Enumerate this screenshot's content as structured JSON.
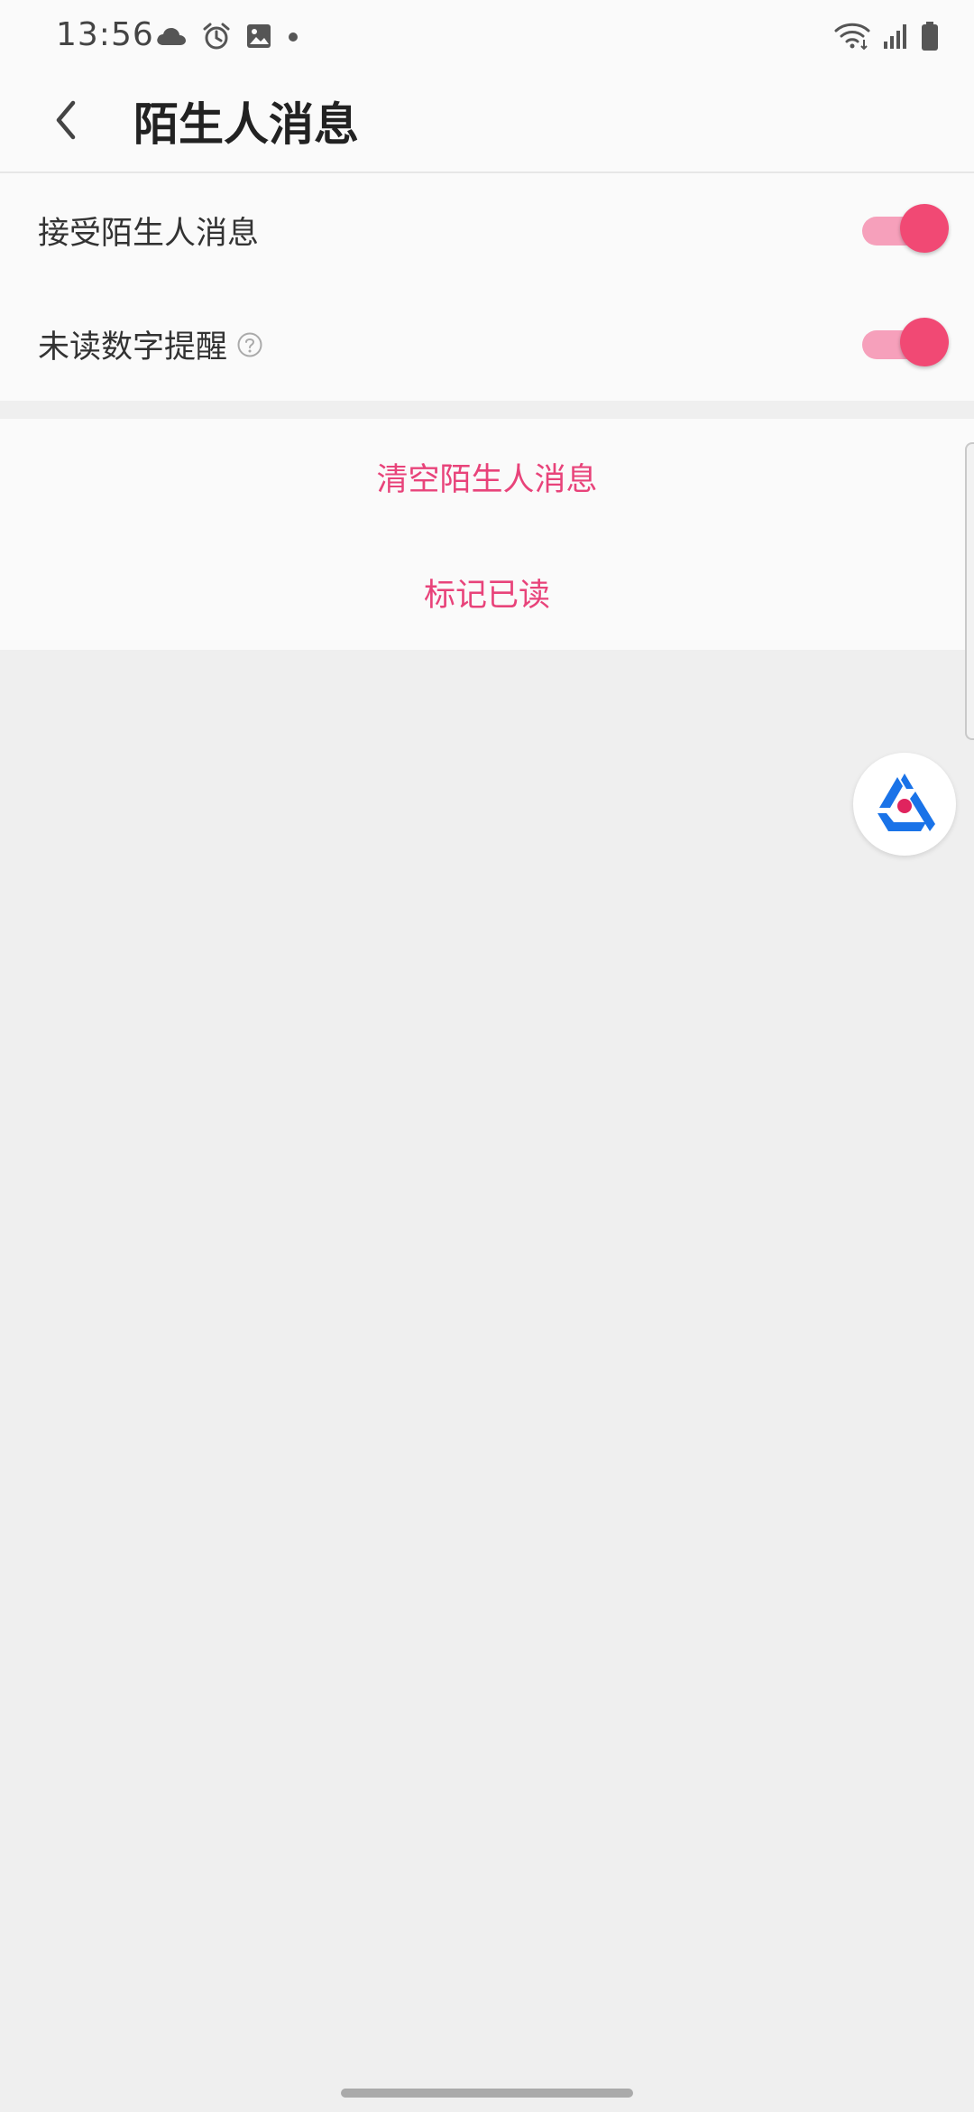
{
  "status_bar": {
    "time": "13:56",
    "left_icons": [
      "cloud-icon",
      "alarm-icon",
      "image-icon",
      "dot-icon"
    ],
    "right_icons": [
      "wifi-icon",
      "signal-icon",
      "battery-icon"
    ]
  },
  "app_bar": {
    "title": "陌生人消息"
  },
  "settings": [
    {
      "label": "接受陌生人消息",
      "enabled": true,
      "has_help": false
    },
    {
      "label": "未读数字提醒",
      "enabled": true,
      "has_help": true
    }
  ],
  "actions": [
    {
      "label": "清空陌生人消息"
    },
    {
      "label": "标记已读"
    }
  ],
  "colors": {
    "accent": "#e8437a",
    "toggle_track": "#f6a0bb",
    "toggle_knob": "#f14974",
    "background": "#efefef",
    "widget_blue": "#1a73e8",
    "widget_red": "#e0245e"
  }
}
